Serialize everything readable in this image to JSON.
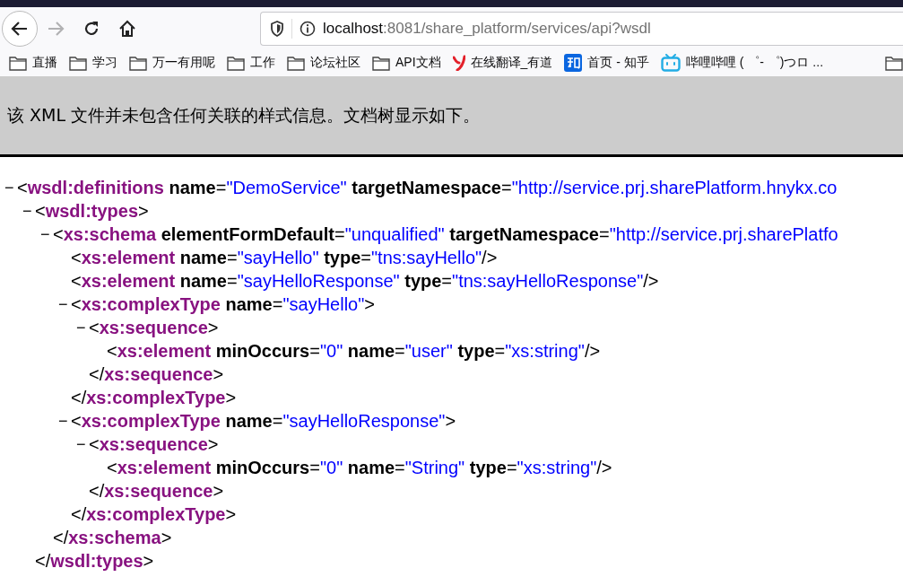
{
  "toolbar": {
    "forward": {
      "disabled": true
    },
    "url_host": "localhost",
    "url_rest": ":8081/share_platform/services/api?wsdl"
  },
  "bookmarks": [
    {
      "kind": "folder",
      "label": "直播"
    },
    {
      "kind": "folder",
      "label": "学习"
    },
    {
      "kind": "folder",
      "label": "万一有用呢"
    },
    {
      "kind": "folder",
      "label": "工作"
    },
    {
      "kind": "folder",
      "label": "论坛社区"
    },
    {
      "kind": "folder",
      "label": "API文档"
    },
    {
      "kind": "youdao",
      "label": "在线翻译_有道"
    },
    {
      "kind": "zhihu",
      "label": "首页 - 知乎"
    },
    {
      "kind": "bilibili",
      "label": "哔哩哔哩 ( ゜- ゜)つロ ..."
    },
    {
      "kind": "folder"
    }
  ],
  "notice": "该 XML 文件并未包含任何关联的样式信息。文档树显示如下。",
  "tree": {
    "toggle": "−",
    "open": "<",
    "tag": "wsdl:definitions",
    "attrs": [
      {
        "name": "name",
        "eq": "=",
        "value": "\"DemoService\""
      },
      {
        "name": "targetNamespace",
        "eq": "=",
        "value": "\"http://service.prj.sharePlatform.hnykx.co"
      }
    ],
    "children": [
      {
        "toggle": "−",
        "open": "<",
        "tag": "wsdl:types",
        "close": ">",
        "children": [
          {
            "toggle": "−",
            "open": "<",
            "tag": "xs:schema",
            "attrs": [
              {
                "name": "elementFormDefault",
                "eq": "=",
                "value": "\"unqualified\""
              },
              {
                "name": "targetNamespace",
                "eq": "=",
                "value": "\"http://service.prj.sharePlatfo"
              }
            ],
            "children": [
              {
                "open": "<",
                "tag": "xs:element",
                "attrs": [
                  {
                    "name": "name",
                    "eq": "=",
                    "value": "\"sayHello\""
                  },
                  {
                    "name": "type",
                    "eq": "=",
                    "value": "\"tns:sayHello\""
                  }
                ],
                "close": "/>"
              },
              {
                "open": "<",
                "tag": "xs:element",
                "attrs": [
                  {
                    "name": "name",
                    "eq": "=",
                    "value": "\"sayHelloResponse\""
                  },
                  {
                    "name": "type",
                    "eq": "=",
                    "value": "\"tns:sayHelloResponse\""
                  }
                ],
                "close": "/>"
              },
              {
                "toggle": "−",
                "open": "<",
                "tag": "xs:complexType",
                "attrs": [
                  {
                    "name": "name",
                    "eq": "=",
                    "value": "\"sayHello\""
                  }
                ],
                "close": ">",
                "children": [
                  {
                    "toggle": "−",
                    "open": "<",
                    "tag": "xs:sequence",
                    "close": ">",
                    "children": [
                      {
                        "open": "<",
                        "tag": "xs:element",
                        "attrs": [
                          {
                            "name": "minOccurs",
                            "eq": "=",
                            "value": "\"0\""
                          },
                          {
                            "name": "name",
                            "eq": "=",
                            "value": "\"user\""
                          },
                          {
                            "name": "type",
                            "eq": "=",
                            "value": "\"xs:string\""
                          }
                        ],
                        "close": "/>"
                      }
                    ],
                    "end": {
                      "open": "</",
                      "tag": "xs:sequence",
                      "close": ">"
                    }
                  }
                ],
                "end": {
                  "open": "</",
                  "tag": "xs:complexType",
                  "close": ">"
                }
              },
              {
                "toggle": "−",
                "open": "<",
                "tag": "xs:complexType",
                "attrs": [
                  {
                    "name": "name",
                    "eq": "=",
                    "value": "\"sayHelloResponse\""
                  }
                ],
                "close": ">",
                "children": [
                  {
                    "toggle": "−",
                    "open": "<",
                    "tag": "xs:sequence",
                    "close": ">",
                    "children": [
                      {
                        "open": "<",
                        "tag": "xs:element",
                        "attrs": [
                          {
                            "name": "minOccurs",
                            "eq": "=",
                            "value": "\"0\""
                          },
                          {
                            "name": "name",
                            "eq": "=",
                            "value": "\"String\""
                          },
                          {
                            "name": "type",
                            "eq": "=",
                            "value": "\"xs:string\""
                          }
                        ],
                        "close": "/>"
                      }
                    ],
                    "end": {
                      "open": "</",
                      "tag": "xs:sequence",
                      "close": ">"
                    }
                  }
                ],
                "end": {
                  "open": "</",
                  "tag": "xs:complexType",
                  "close": ">"
                }
              }
            ],
            "end": {
              "open": "</",
              "tag": "xs:schema",
              "close": ">"
            }
          }
        ],
        "end": {
          "open": "</",
          "tag": "wsdl:types",
          "close": ">"
        }
      }
    ]
  }
}
